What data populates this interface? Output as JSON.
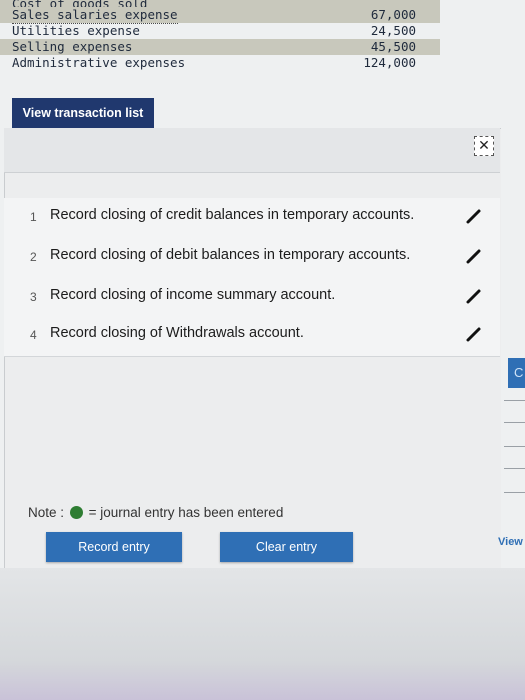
{
  "ledger": [
    {
      "name": "Cost of goods sold",
      "amount": "",
      "style": "band"
    },
    {
      "name": "Sales salaries expense",
      "amount": "67,000",
      "style": "shade"
    },
    {
      "name": "Utilities expense",
      "amount": "24,500",
      "style": "plain"
    },
    {
      "name": "Selling expenses",
      "amount": "45,500",
      "style": "shade"
    },
    {
      "name": "Administrative expenses",
      "amount": "124,000",
      "style": "plain"
    }
  ],
  "tab": {
    "label": "View transaction list"
  },
  "close_icon": "✕",
  "tasks": [
    {
      "num": "1",
      "text": "Record closing of credit balances in temporary accounts."
    },
    {
      "num": "2",
      "text": "Record closing of debit balances in temporary accounts."
    },
    {
      "num": "3",
      "text": "Record closing of income summary account."
    },
    {
      "num": "4",
      "text": "Record closing of Withdrawals account."
    }
  ],
  "note": {
    "prefix": "Note :",
    "suffix": "= journal entry has been entered"
  },
  "buttons": {
    "record": "Record entry",
    "clear": "Clear entry"
  },
  "right_edge": {
    "c_label": "C",
    "view_label": "View"
  },
  "colors": {
    "tab_bg": "#20386e",
    "button_bg": "#2f6fb5",
    "entered_dot": "#2e7d32",
    "pencil": "#111111"
  }
}
